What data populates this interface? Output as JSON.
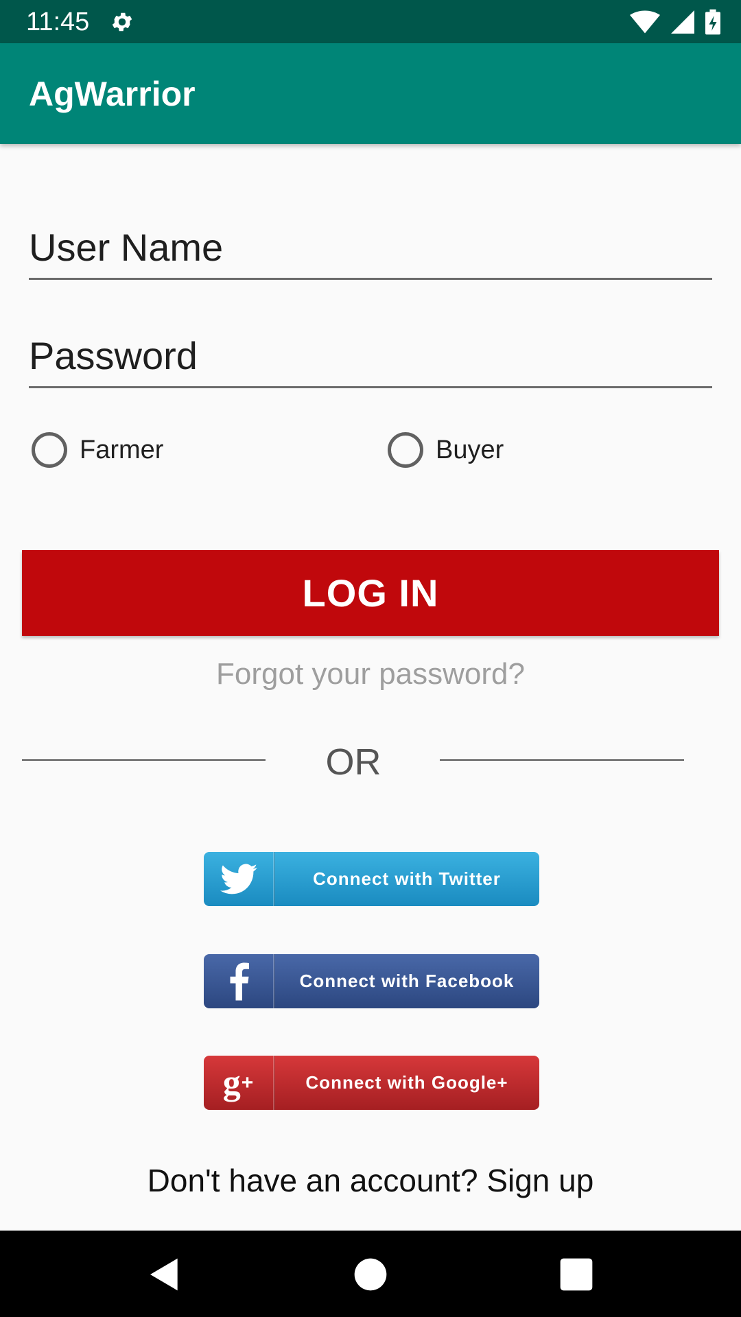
{
  "status_bar": {
    "time": "11:45",
    "icons": [
      "gear-icon",
      "wifi-icon",
      "signal-icon",
      "battery-charging-icon"
    ]
  },
  "app_bar": {
    "title": "AgWarrior"
  },
  "form": {
    "username_placeholder": "User Name",
    "password_placeholder": "Password",
    "roles": [
      {
        "label": "Farmer",
        "selected": false
      },
      {
        "label": "Buyer",
        "selected": false
      }
    ],
    "login_label": "LOG IN",
    "forgot_label": "Forgot your password?"
  },
  "divider": {
    "label": "OR"
  },
  "social": {
    "twitter_label": "Connect with Twitter",
    "facebook_label": "Connect with Facebook",
    "google_label": "Connect with Google+",
    "google_icon_text": "g",
    "google_icon_plus": "+",
    "colors": {
      "twitter": "#1a8bc0",
      "facebook": "#2c4780",
      "google": "#a51f22"
    }
  },
  "signup": {
    "label": "Don't have an account? Sign up"
  },
  "nav_bar": {
    "icons": [
      "back-icon",
      "home-icon",
      "recents-icon"
    ]
  },
  "colors": {
    "status_bar": "#00574b",
    "app_bar": "#008577",
    "login_button": "#c0080c"
  }
}
